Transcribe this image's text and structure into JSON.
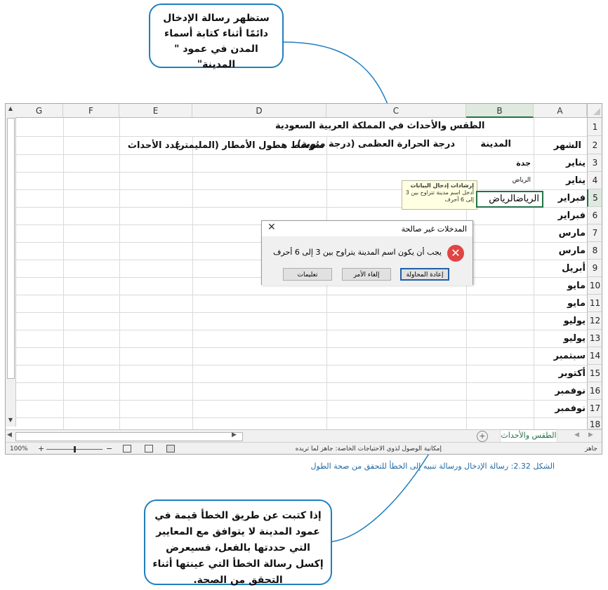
{
  "callouts": {
    "top": "ستظهر رسالة الإدخال دائمًا أثناء كتابة أسماء المدن في عمود \" المدينة\"",
    "bottom": "إذا كتبت عن طريق الخطأ قيمة في عمود المدينة لا يتوافق مع المعايير التي حددتها بالفعل، فسيعرض إكسل رسالة الخطأ التي عينتها أثناء التحقق من الصحة."
  },
  "caption": "الشكل 2.32: رسالة الإدخال ورسالة تنبيه إلى الخطأ للتحقق من صحة الطول",
  "sheet": {
    "columns": [
      "A",
      "B",
      "C",
      "D",
      "E",
      "F",
      "G"
    ],
    "rows": [
      "1",
      "2",
      "3",
      "4",
      "5",
      "6",
      "7",
      "8",
      "9",
      "10",
      "11",
      "12",
      "13",
      "14",
      "15",
      "16",
      "17",
      "18"
    ],
    "title": "الطقس والأحداث في المملكة العربية السعودية",
    "headers": {
      "month": "الشهر",
      "city": "المدينة",
      "temp": "درجة الحرارة العظمى (درجة مئوية)",
      "rain": "متوسط هطول الأمطار (المليمتر)",
      "events": "عدد الأحداث"
    },
    "months": [
      "يناير",
      "يناير",
      "فبراير",
      "فبراير",
      "مارس",
      "مارس",
      "أبريل",
      "مايو",
      "مايو",
      "يوليو",
      "يوليو",
      "سبتمبر",
      "أكتوبر",
      "نوفمبر",
      "نوفمبر"
    ],
    "cities": [
      "جدة",
      "الرياض"
    ],
    "active_cell_value": "الرياضالرياض"
  },
  "tooltip": {
    "title": "إرشادات إدخال البيانات",
    "body": "أدخل اسم مدينة تتراوح بين 3 إلى 6 أحرف"
  },
  "dialog": {
    "title": "المدخلات غير صالحة",
    "message": "يجب أن يكون اسم المدينة يتراوح بين 3 إلى 6 أحرف",
    "retry": "إعادة المحاولة",
    "cancel": "إلغاء الأمر",
    "help": "تعليمات"
  },
  "tabs": {
    "sheet_name": "الطقس والأحداث"
  },
  "status": {
    "ready": "جاهز",
    "accessibility": "إمكانية الوصول لذوي الاحتياجات الخاصة: جاهز لما تريده",
    "zoom": "100%"
  },
  "colors": {
    "accent": "#217346",
    "callout_border": "#1f7fbf",
    "error": "#e04444"
  }
}
